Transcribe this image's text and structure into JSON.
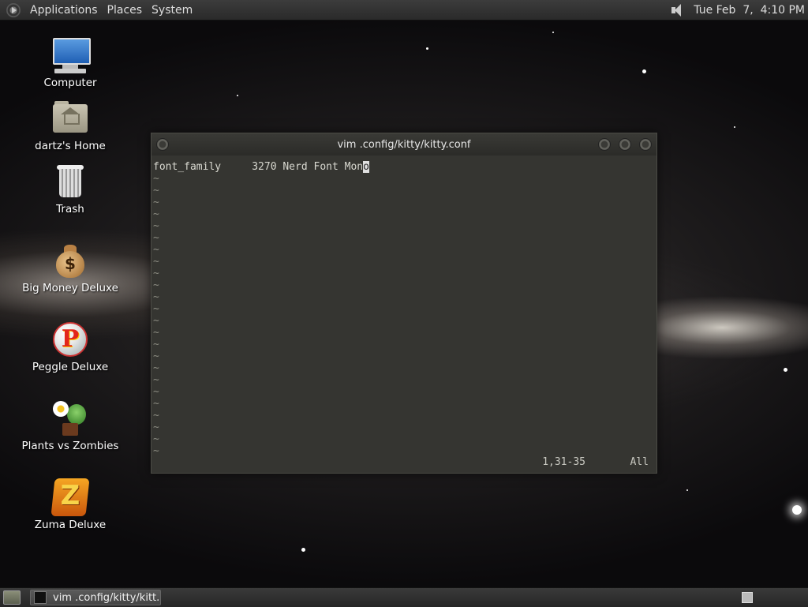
{
  "top_panel": {
    "menus": [
      "Applications",
      "Places",
      "System"
    ],
    "clock": "Tue Feb  7,  4:10 PM",
    "icons": [
      "menu-logo-icon",
      "speaker-icon"
    ]
  },
  "desktop": {
    "icons": [
      {
        "label": "Computer",
        "icon": "computer-icon"
      },
      {
        "label": "dartz's Home",
        "icon": "home-folder-icon"
      },
      {
        "label": "Trash",
        "icon": "trash-icon"
      },
      {
        "label": "Big Money Deluxe",
        "icon": "money-bag-icon"
      },
      {
        "label": "Peggle Deluxe",
        "icon": "peggle-icon"
      },
      {
        "label": "Plants vs Zombies",
        "icon": "plants-icon"
      },
      {
        "label": "Zuma Deluxe",
        "icon": "zuma-icon"
      }
    ]
  },
  "window": {
    "title": "vim .config/kitty/kitty.conf",
    "line1_before_cursor": "font_family     3270 Nerd Font Mon",
    "cursor_char": "o",
    "tilde": "~",
    "status_position": "1,31-35",
    "status_scroll": "All"
  },
  "bottom_panel": {
    "task_label": "vim .config/kitty/kitt...",
    "icons": [
      "show-desktop-icon",
      "terminal-icon",
      "workspace-icon"
    ]
  },
  "colors": {
    "panel": "#2f2f2f",
    "terminal_bg": "#353531",
    "window_border": "#4a4a44"
  }
}
